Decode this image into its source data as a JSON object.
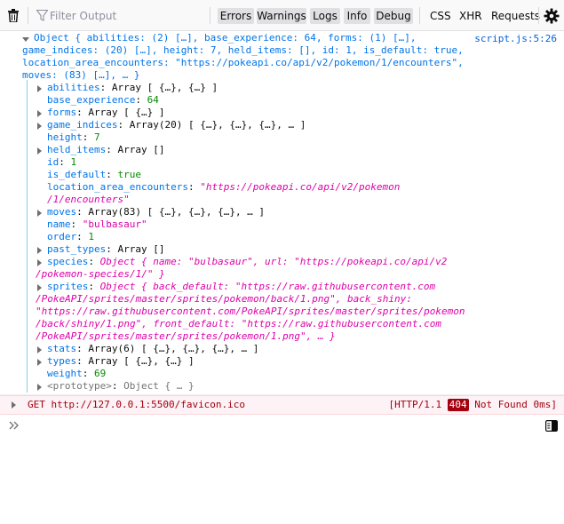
{
  "toolbar": {
    "filter_placeholder": "Filter Output",
    "levels": [
      "Errors",
      "Warnings",
      "Logs",
      "Info",
      "Debug"
    ],
    "requests": [
      "CSS",
      "XHR",
      "Requests"
    ],
    "icons": [
      "trash-icon",
      "filter-icon",
      "gear-icon"
    ]
  },
  "log": {
    "location": "script.js:5:26",
    "summary": [
      "Object { abilities: (2) […], base_experience: 64, forms: (1) […],",
      "game_indices: (20) […], height: 7, held_items: [], id: 1, is_default: true,",
      "location_area_encounters: \"https://pokeapi.co/api/v2/pokemon/1/encounters\",",
      "moves: (83) […], … }"
    ],
    "props": {
      "abilities": "Array [ {…}, {…} ]",
      "base_experience": "64",
      "forms": "Array [ {…} ]",
      "game_indices": "Array(20) [ {…}, {…}, {…}, … ]",
      "height": "7",
      "held_items": "Array []",
      "id": "1",
      "is_default": "true",
      "location_area_encounters_1": "\"https://pokeapi.co/api/v2/pokemon",
      "location_area_encounters_2": "/1/encounters\"",
      "moves": "Array(83) [ {…}, {…}, {…}, … ]",
      "name": "\"bulbasaur\"",
      "order": "1",
      "past_types": "Array []",
      "species_1": "Object { name: \"bulbasaur\", url: \"https://pokeapi.co/api/v2",
      "species_2": "/pokemon-species/1/\" }",
      "sprites_1": "Object { back_default: \"https://raw.githubusercontent.com",
      "sprites_2": "/PokeAPI/sprites/master/sprites/pokemon/back/1.png\", back_shiny:",
      "sprites_3": "\"https://raw.githubusercontent.com/PokeAPI/sprites/master/sprites/pokemon",
      "sprites_4": "/back/shiny/1.png\", front_default: \"https://raw.githubusercontent.com",
      "sprites_5": "/PokeAPI/sprites/master/sprites/pokemon/1.png\", … }",
      "stats": "Array(6) [ {…}, {…}, {…}, … ]",
      "types": "Array [ {…}, {…} ]",
      "weight": "69",
      "prototype": "Object { … }"
    }
  },
  "network": {
    "method": "GET",
    "url": "http://127.0.0.1:5500/favicon.ico",
    "http": "[HTTP/1.1",
    "code": "404",
    "status_text": "Not Found 0ms]"
  },
  "prompt": {
    "chevron": "»"
  }
}
